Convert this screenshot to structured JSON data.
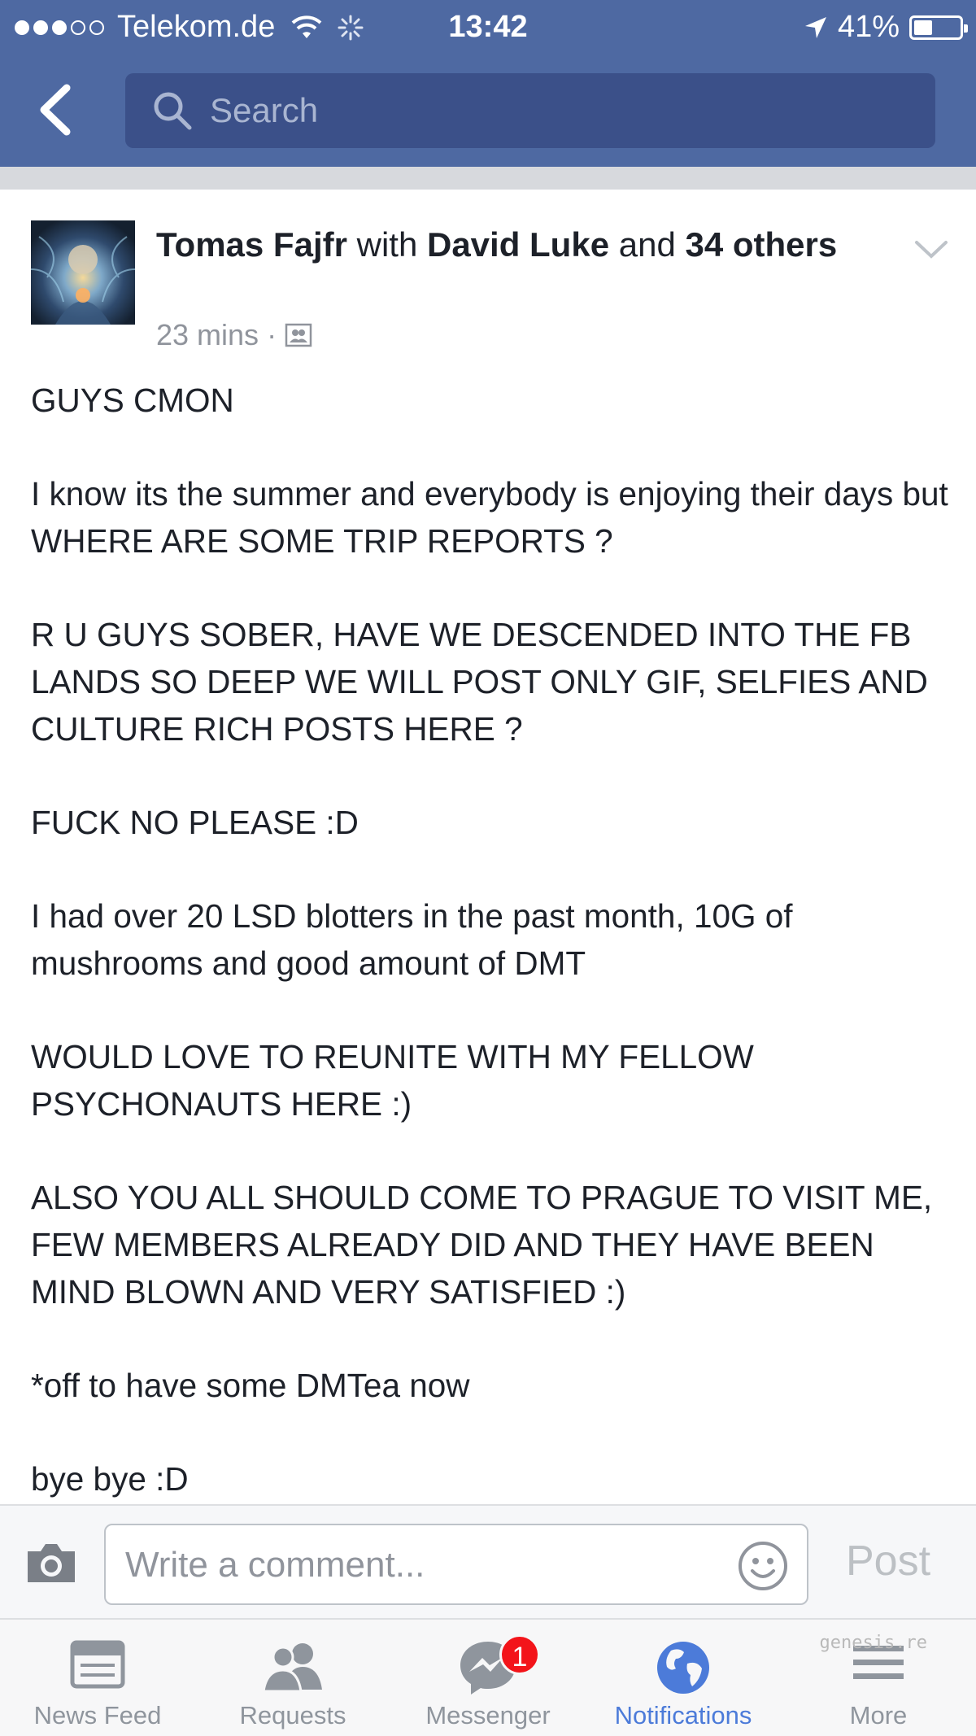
{
  "status_bar": {
    "carrier": "Telekom.de",
    "time": "13:42",
    "battery": "41%",
    "battery_level": 0.41
  },
  "header": {
    "search_placeholder": "Search"
  },
  "post": {
    "author": "Tomas Fajfr",
    "with_word": "with",
    "tagged": "David Luke",
    "and_word": "and",
    "others": "34 others",
    "time": "23 mins",
    "body": [
      "GUYS CMON",
      "I know its the summer and everybody is enjoying their days but WHERE ARE SOME TRIP REPORTS ?",
      "R U GUYS SOBER, HAVE WE DESCENDED INTO THE FB LANDS SO DEEP WE WILL POST ONLY GIF, SELFIES AND CULTURE RICH POSTS HERE ?",
      "FUCK NO PLEASE :D",
      "I had over 20 LSD blotters in the past month, 10G of mushrooms and good amount of DMT",
      "WOULD LOVE TO REUNITE WITH MY FELLOW PSYCHONAUTS HERE :)",
      "ALSO YOU ALL SHOULD COME TO PRAGUE TO VISIT ME, FEW MEMBERS ALREADY DID AND THEY HAVE BEEN MIND BLOWN AND VERY SATISFIED :)",
      "*off to have some DMTea now",
      "bye bye :D"
    ]
  },
  "comment": {
    "placeholder": "Write a comment...",
    "post_label": "Post"
  },
  "tabs": [
    {
      "label": "News Feed",
      "icon": "news-feed-icon"
    },
    {
      "label": "Requests",
      "icon": "friends-icon"
    },
    {
      "label": "Messenger",
      "icon": "messenger-icon",
      "badge": "1"
    },
    {
      "label": "Notifications",
      "icon": "globe-icon",
      "active": true
    },
    {
      "label": "More",
      "icon": "menu-icon"
    }
  ],
  "watermark": "genesis.re",
  "colors": {
    "header": "#4e69a2",
    "search_field": "#3b5089",
    "active_tab": "#4c7bd9",
    "badge": "#f3141a"
  }
}
